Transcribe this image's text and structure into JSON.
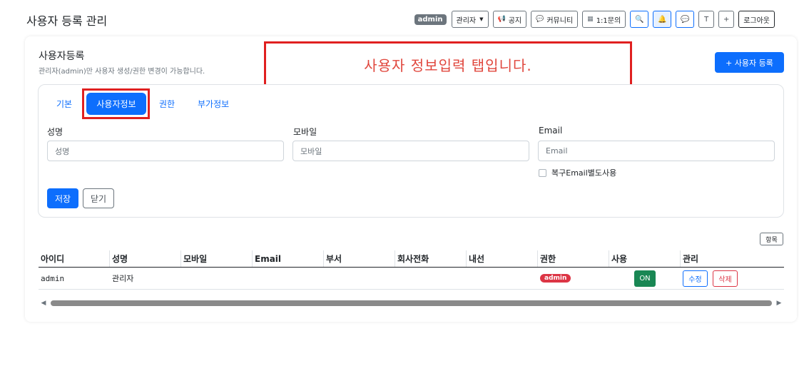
{
  "app": {
    "title": "사용자 등록 관리"
  },
  "topbar": {
    "role_badge": "admin",
    "user_menu": "관리자",
    "notice": "공지",
    "community": "커뮤니티",
    "inquiry": "1:1문의",
    "icons": [
      "search-icon",
      "bell-icon",
      "chat-icon"
    ],
    "text_size": "T",
    "plus": "+",
    "logout": "로그아웃"
  },
  "section": {
    "title": "사용자등록",
    "subtitle": "관리자(admin)만 사용자 생성/권한 변경이 가능합니다.",
    "register_button": "+ 사용자 등록"
  },
  "callout": {
    "text": "사용자 정보입력 탭입니다."
  },
  "tabs": [
    {
      "label": "기본",
      "active": false
    },
    {
      "label": "사용자정보",
      "active": true
    },
    {
      "label": "권한",
      "active": false
    },
    {
      "label": "부가정보",
      "active": false
    }
  ],
  "form": {
    "name": {
      "label": "성명",
      "placeholder": "성명"
    },
    "mobile": {
      "label": "모바일",
      "placeholder": "모바일"
    },
    "email": {
      "label": "Email",
      "placeholder": "Email"
    },
    "recovery_email_checkbox": "복구Email별도사용",
    "save_button": "저장",
    "close_button": "닫기"
  },
  "table": {
    "items_button": "항목",
    "columns": [
      "아이디",
      "성명",
      "모바일",
      "Email",
      "부서",
      "회사전화",
      "내선",
      "권한",
      "사용",
      "관리"
    ],
    "rows": [
      {
        "id": "admin",
        "name": "관리자",
        "mobile": "",
        "email": "",
        "department": "",
        "company_phone": "",
        "extension": "",
        "role": "admin",
        "active": "ON",
        "edit": "수정",
        "delete": "삭제"
      }
    ]
  },
  "colors": {
    "primary": "#0d6efd",
    "danger": "#dc3545",
    "success": "#198754",
    "callout_border": "#e02020",
    "callout_text": "#e0463c"
  }
}
